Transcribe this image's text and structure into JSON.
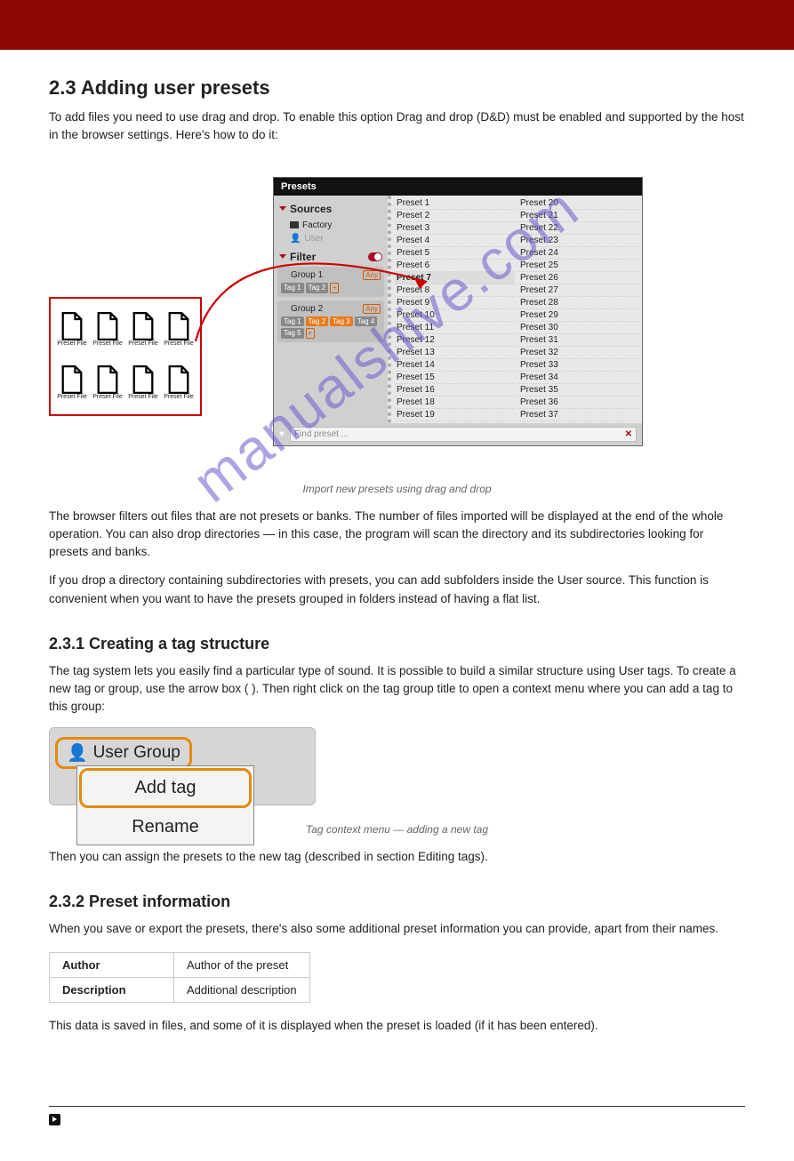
{
  "heading": "2.3 Adding user presets",
  "intro": "To add files you need to use drag and drop. To enable this option Drag and drop (D&D) must be enabled and supported by the host in the browser settings. Here's how to do it:",
  "preset_icon_label": "Preset File",
  "browser": {
    "title": "Presets",
    "sources_label": "Sources",
    "factory": "Factory",
    "user": "User",
    "filter_label": "Filter",
    "group1": {
      "name": "Group 1",
      "any": "Any",
      "tags": [
        "Tag 1",
        "Tag 2"
      ],
      "plus": "+"
    },
    "group2": {
      "name": "Group 2",
      "any": "Any",
      "tags": [
        "Tag 1",
        "Tag 2",
        "Tag 3",
        "Tag 4",
        "Tag 5"
      ],
      "plus": "+"
    },
    "find_placeholder": "Find preset ...",
    "col1": [
      "Preset 1",
      "Preset 2",
      "Preset 3",
      "Preset 4",
      "Preset 5",
      "Preset 6",
      "Preset 7",
      "Preset 8",
      "Preset 9",
      "Preset 10",
      "Preset 11",
      "Preset 12",
      "Preset 13",
      "Preset 14",
      "Preset 15",
      "Preset 16",
      "Preset 18",
      "Preset 19"
    ],
    "col2": [
      "Preset 20",
      "Preset 21",
      "Preset 22",
      "Preset 23",
      "Preset 24",
      "Preset 25",
      "Preset 26",
      "Preset 27",
      "Preset 28",
      "Preset 29",
      "Preset 30",
      "Preset 31",
      "Preset 32",
      "Preset 33",
      "Preset 34",
      "Preset 35",
      "Preset 36",
      "Preset 37"
    ]
  },
  "caption": "Import new presets using drag and drop",
  "after_fig_1": "The browser filters out files that are not presets or banks. The number of files imported will be displayed at the end of the whole operation. You can also drop directories — in this case, the program will scan the directory and its subdirectories looking for presets and banks.",
  "after_fig_2": "If you drop a directory containing subdirectories with presets, you can add subfolders inside the User source. This function is convenient when you want to have the presets grouped in folders instead of having a flat list.",
  "create_tags_heading": "2.3.1 Creating a tag structure",
  "create_tags_p1": "The tag system lets you easily find a particular type of sound. It is possible to build a similar structure using User tags. To create a new tag or group, use the arrow box (    ). Then right click on the tag group title to open a context menu where you can add a tag to this group:",
  "ctx": {
    "user_group": "User Group",
    "add_tag": "Add tag",
    "rename": "Rename"
  },
  "ctx_caption": "Tag context menu — adding a new tag",
  "after_ctx": "Then you can assign the presets to the new tag (described in section Editing tags).",
  "info_heading": "2.3.2 Preset information",
  "info_intro": "When you save or export the presets, there's also some additional preset information you can provide, apart from their names.",
  "info_rows": [
    [
      "Author",
      "Author of the preset"
    ],
    [
      "Description",
      "Additional description"
    ]
  ],
  "info_after": "This data is saved in files, and some of it is displayed when the preset is loaded (if it has been entered).",
  "watermark_text": "manualshive.com"
}
